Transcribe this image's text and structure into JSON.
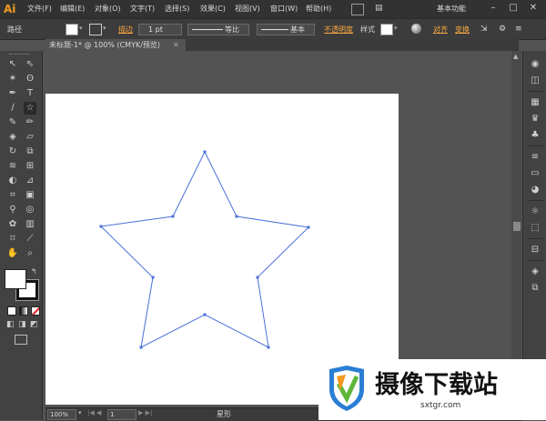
{
  "app": {
    "logo": "Ai",
    "workspace": "基本功能"
  },
  "menu": {
    "items": [
      "文件(F)",
      "编辑(E)",
      "对象(O)",
      "文字(T)",
      "选择(S)",
      "效果(C)",
      "视图(V)",
      "窗口(W)",
      "帮助(H)"
    ]
  },
  "control": {
    "object_type": "路径",
    "stroke_label": "描边",
    "stroke_weight": "1 pt",
    "profile_label": "等比",
    "brush_label": "基本",
    "opacity_label": "不透明度",
    "style_label": "样式",
    "align_label": "对齐",
    "transform_label": "变换"
  },
  "document": {
    "tab_title": "未标题-1* @ 100% (CMYK/预览)"
  },
  "status": {
    "zoom": "100%",
    "page": "1",
    "tool_label": "星形"
  },
  "watermark": {
    "text": "摄像下载站",
    "url": "sxtgr.com"
  },
  "colors": {
    "path_stroke": "#4a6fd8",
    "accent": "#f39a1c",
    "watermark_orange": "#f39a1c",
    "watermark_blue": "#2a7fd4",
    "watermark_green": "#5db63b"
  },
  "icons": {
    "tools": [
      "selection-icon",
      "direct-selection-icon",
      "magic-wand-icon",
      "lasso-icon",
      "pen-icon",
      "type-icon",
      "line-icon",
      "star-icon",
      "paintbrush-icon",
      "pencil-icon",
      "blob-brush-icon",
      "eraser-icon",
      "rotate-icon",
      "scale-icon",
      "warp-icon",
      "free-transform-icon",
      "shape-builder-icon",
      "perspective-icon",
      "mesh-icon",
      "gradient-icon",
      "eyedropper-icon",
      "blend-icon",
      "symbol-sprayer-icon",
      "column-graph-icon",
      "artboard-icon",
      "slice-icon",
      "hand-icon",
      "zoom-icon"
    ],
    "right_panel": [
      "color-icon",
      "color-guide-icon",
      "swatches-icon",
      "brushes-icon",
      "symbols-icon",
      "graphic-styles-icon",
      "stroke-icon",
      "gradient-icon",
      "transparency-icon",
      "appearance-icon",
      "align-icon",
      "layers-icon",
      "artboards-icon"
    ]
  }
}
